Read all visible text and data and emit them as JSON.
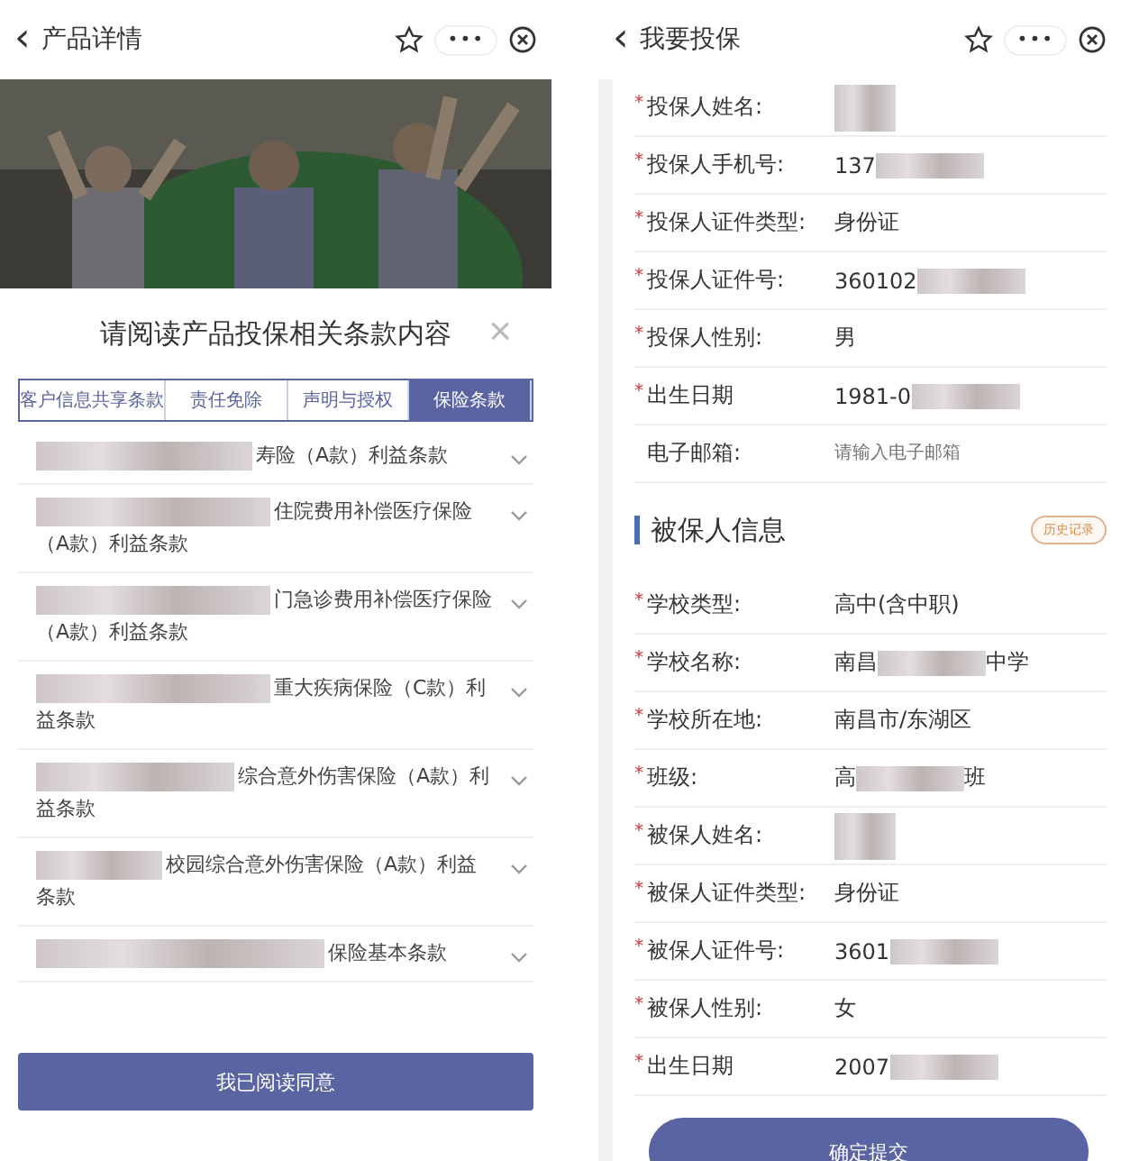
{
  "left_screen": {
    "nav_bar": {
      "back": "‹",
      "title": "产品详情",
      "more": "•••"
    },
    "sheet": {
      "title": "请阅读产品投保相关条款内容",
      "close": "×",
      "tabs": [
        {
          "label": "客户信息共享条款",
          "selected": false
        },
        {
          "label": "责任免除",
          "selected": false
        },
        {
          "label": "声明与授权",
          "selected": false
        },
        {
          "label": "保险条款",
          "selected": true
        }
      ],
      "clauses": [
        {
          "redacted": true,
          "text": "寿险（A款）利益条款"
        },
        {
          "redacted": true,
          "text": "住院费用补偿医疗保险（A款）利益条款"
        },
        {
          "redacted": true,
          "text": "门急诊费用补偿医疗保险（A款）利益条款"
        },
        {
          "redacted": true,
          "text": "重大疾病保险（C款）利益条款"
        },
        {
          "redacted": true,
          "text": "综合意外伤害保险（A款）利益条款"
        },
        {
          "redacted": true,
          "text": "校园综合意外伤害保险（A款）利益条款"
        },
        {
          "redacted": true,
          "text": "保险基本条款"
        }
      ],
      "agree_button": "我已阅读同意"
    }
  },
  "right_screen": {
    "nav_bar": {
      "back": "‹",
      "title": "我要投保",
      "more": "•••"
    },
    "policyholder_fields": [
      {
        "required_mark": "*",
        "label": "投保人姓名:",
        "redacted": true
      },
      {
        "required_mark": "*",
        "label": "投保人手机号:",
        "value": "137",
        "redacted": true
      },
      {
        "required_mark": "*",
        "label": "投保人证件类型:",
        "value": "身份证"
      },
      {
        "required_mark": "*",
        "label": "投保人证件号:",
        "value": "360102",
        "redacted": true
      },
      {
        "required_mark": "*",
        "label": "投保人性别:",
        "value": "男"
      },
      {
        "required_mark": "*",
        "label": "出生日期",
        "value": "1981-0",
        "redacted": true
      },
      {
        "label": "电子邮箱:",
        "placeholder": "请输入电子邮箱"
      }
    ],
    "insured_section": {
      "title": "被保人信息",
      "history_button": "历史记录"
    },
    "insured_fields": [
      {
        "required_mark": "*",
        "label": "学校类型:",
        "value": "高中(含中职)"
      },
      {
        "required_mark": "*",
        "label": "学校名称:",
        "value": "南昌",
        "redacted": true,
        "suffix": "中学"
      },
      {
        "required_mark": "*",
        "label": "学校所在地:",
        "value": "南昌市/东湖区"
      },
      {
        "required_mark": "*",
        "label": "班级:",
        "value": "高",
        "redacted": true,
        "suffix": "班"
      },
      {
        "required_mark": "*",
        "label": "被保人姓名:",
        "redacted": true
      },
      {
        "required_mark": "*",
        "label": "被保人证件类型:",
        "value": "身份证"
      },
      {
        "required_mark": "*",
        "label": "被保人证件号:",
        "value": "3601",
        "redacted": true
      },
      {
        "required_mark": "*",
        "label": "被保人性别:",
        "value": "女"
      },
      {
        "required_mark": "*",
        "label": "出生日期",
        "value": "2007",
        "redacted": true
      }
    ],
    "submit_button": "确定提交"
  }
}
